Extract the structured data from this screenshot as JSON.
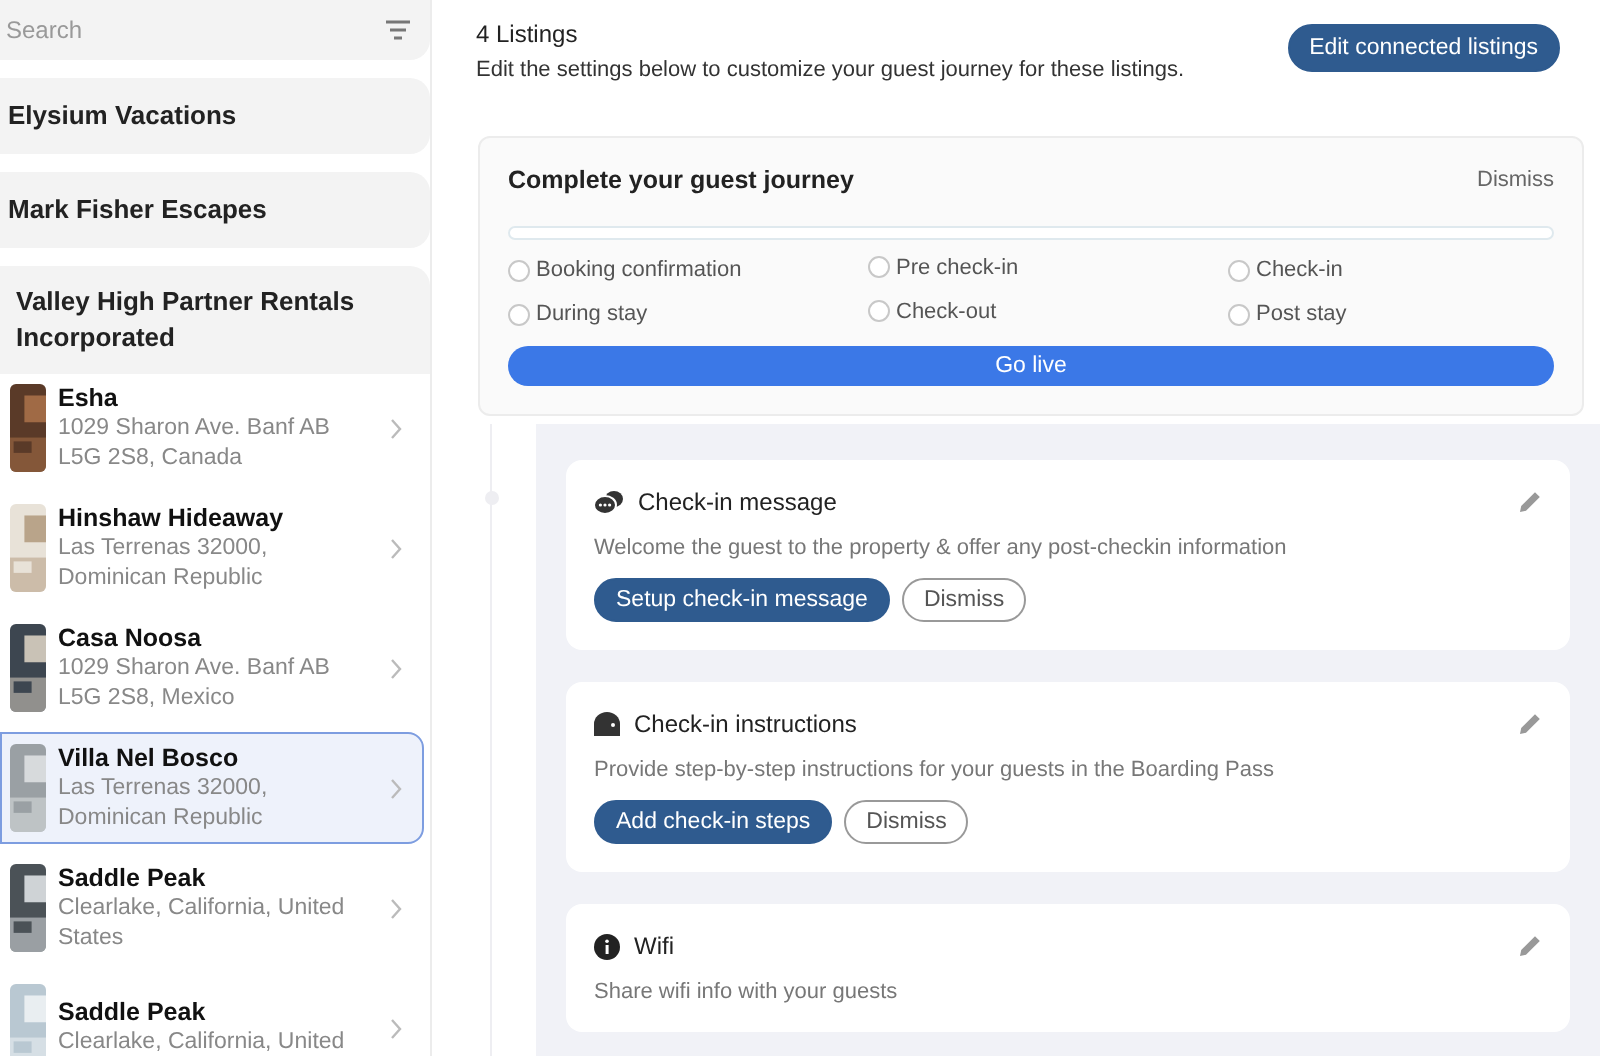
{
  "sidebar": {
    "search": {
      "placeholder": "Search"
    },
    "groups": [
      {
        "name": "Elysium Vacations",
        "expanded": false
      },
      {
        "name": "Mark Fisher Escapes",
        "expanded": false
      },
      {
        "name": "Valley High Partner Rentals Incorporated",
        "expanded": true,
        "listings": [
          {
            "name": "Esha",
            "address": "1029 Sharon Ave. Banf AB L5G 2S8, Canada",
            "selected": false
          },
          {
            "name": "Hinshaw Hideaway",
            "address": "Las Terrenas 32000, Dominican Republic",
            "selected": false
          },
          {
            "name": "Casa Noosa",
            "address": "1029 Sharon Ave. Banf AB L5G 2S8, Mexico",
            "selected": false
          },
          {
            "name": "Villa Nel Bosco",
            "address": "Las Terrenas 32000, Dominican Republic",
            "selected": true
          },
          {
            "name": "Saddle Peak",
            "address": "Clearlake, California, United States",
            "selected": false
          },
          {
            "name": "Saddle Peak",
            "address": "Clearlake, California, United",
            "selected": false
          }
        ]
      }
    ]
  },
  "header": {
    "title": "4 Listings",
    "subtitle": "Edit the settings below to customize your guest journey for these listings.",
    "button": "Edit connected listings"
  },
  "journey": {
    "title": "Complete your guest journey",
    "dismiss": "Dismiss",
    "progress": {
      "level": 0
    },
    "steps": [
      {
        "label": "Booking confirmation",
        "checked": false
      },
      {
        "label": "Pre check-in",
        "checked": false
      },
      {
        "label": "Check-in",
        "checked": false
      },
      {
        "label": "During stay",
        "checked": false
      },
      {
        "label": "Check-out",
        "checked": false
      },
      {
        "label": "Post stay",
        "checked": false
      }
    ],
    "go_live": "Go live"
  },
  "cards": [
    {
      "kind": "message",
      "title": "Check-in message",
      "description": "Welcome the guest to the property & offer any post-checkin information",
      "buttons": [
        {
          "label": "Setup check-in message",
          "kind": "primary"
        },
        {
          "label": "Dismiss",
          "kind": "secondary"
        }
      ]
    },
    {
      "kind": "instructions",
      "title": "Check-in instructions",
      "description": "Provide step-by-step instructions for your guests in the Boarding Pass",
      "buttons": [
        {
          "label": "Add check-in steps",
          "kind": "primary"
        },
        {
          "label": "Dismiss",
          "kind": "secondary"
        }
      ]
    },
    {
      "kind": "wifi",
      "title": "Wifi",
      "description": "Share wifi info with your guests"
    }
  ]
}
